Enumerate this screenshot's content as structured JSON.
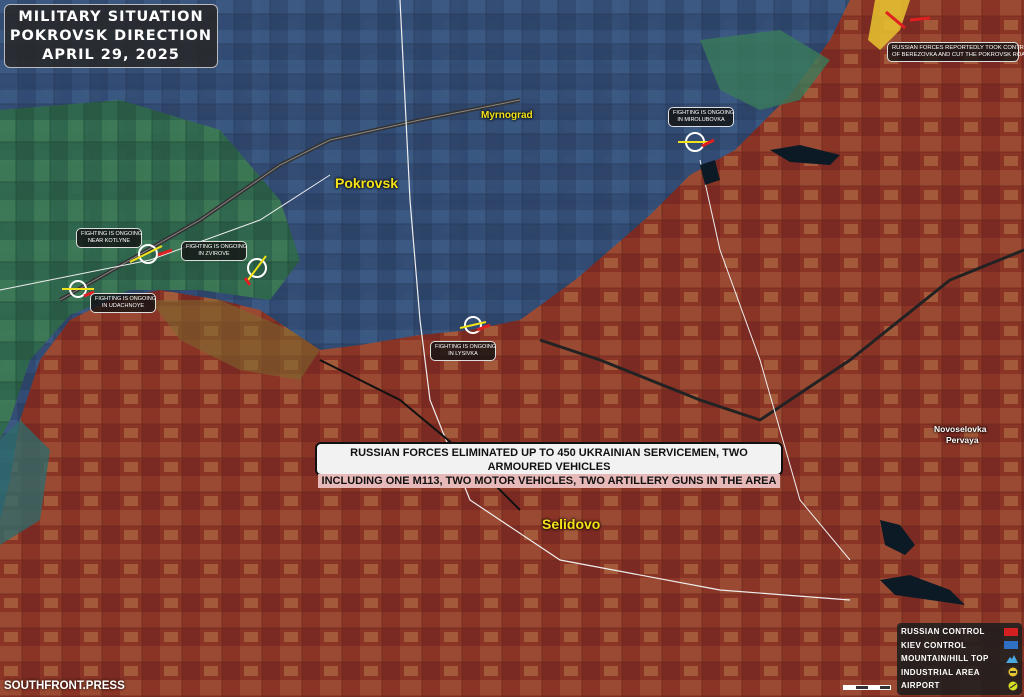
{
  "title": {
    "line1": "MILITARY SITUATION",
    "line2": "POKROVSK DIRECTION",
    "line3": "APRIL 29, 2025"
  },
  "cities": {
    "pokrovsk": "Pokrovsk",
    "myrnograd": "Myrnograd",
    "selidovo": "Selidovo",
    "novoselovka": "Novoselovka",
    "novoselovka2": "Pervaya"
  },
  "fighting_labels": [
    {
      "line1": "FIGHTING IS ONGOING",
      "line2": "NEAR KOTLYNE"
    },
    {
      "line1": "FIGHTING IS ONGOING",
      "line2": "IN ZVIROVE"
    },
    {
      "line1": "FIGHTING IS ONGOING",
      "line2": "IN UDACHNOYE"
    },
    {
      "line1": "FIGHTING IS ONGOING",
      "line2": "IN LYSIVKA"
    },
    {
      "line1": "FIGHTING IS ONGOING",
      "line2": "IN MIROLUBOVKA"
    }
  ],
  "berezovka_note": {
    "line1": "RUSSIAN FORCES REPORTEDLY TOOK CONTROL",
    "line2": "OF BEREZOVKA AND CUT THE POKROVSK ROAD"
  },
  "banner": {
    "line1": "RUSSIAN FORCES ELIMINATED UP TO 450 UKRAINIAN SERVICEMEN, TWO ARMOURED VEHICLES",
    "line2": "INCLUDING ONE M113, TWO MOTOR VEHICLES, TWO ARTILLERY GUNS IN THE AREA"
  },
  "legend": [
    {
      "label": "RUSSIAN CONTROL",
      "icon": "red-square",
      "color": "#d42020"
    },
    {
      "label": "KIEV CONTROL",
      "icon": "blue-square",
      "color": "#2f6fc4"
    },
    {
      "label": "MOUNTAIN/HILL TOP",
      "icon": "mountain-icon",
      "color": "#4aa8e0"
    },
    {
      "label": "INDUSTRIAL AREA",
      "icon": "industrial-icon",
      "color": "#e8c630"
    },
    {
      "label": "AIRPORT",
      "icon": "airport-icon",
      "color": "#d8e020"
    }
  ],
  "footer": "SOUTHFRONT.PRESS",
  "colors": {
    "russian": "#8c2f22",
    "kiev": "#2c4a78",
    "accent_yellow": "#f5e21a"
  }
}
